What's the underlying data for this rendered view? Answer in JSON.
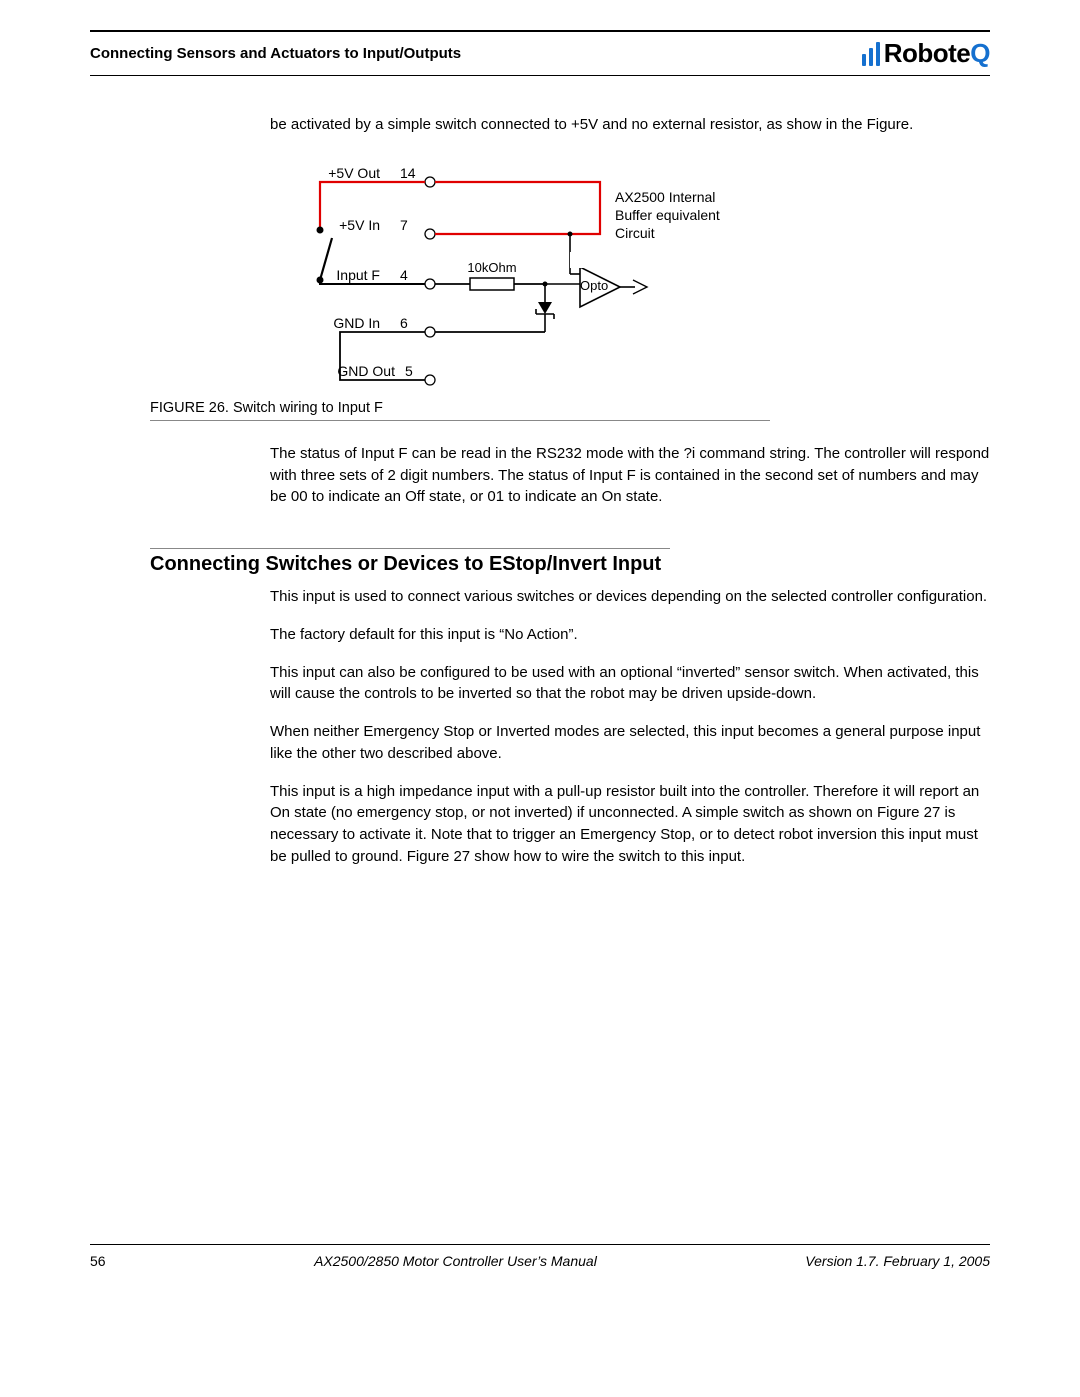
{
  "header": {
    "title": "Connecting Sensors and Actuators to Input/Outputs",
    "logo_text_a": "Robote",
    "logo_text_b": "Q"
  },
  "body": {
    "p_intro": "be activated by a simple switch connected to +5V and no external resistor, as show in the Figure.",
    "p_status": "The status of Input F can be read in the RS232 mode with the ?i command string. The controller will respond with three sets of 2 digit numbers. The status of Input F is contained in the second set of numbers and may be 00 to indicate an Off state, or 01 to indicate an On state.",
    "section_heading": "Connecting Switches or Devices to EStop/Invert Input",
    "p_sec1": "This input is used to connect various switches or devices depending on the selected controller configuration.",
    "p_sec2": "The factory default for this input is “No Action”.",
    "p_sec3": "This input can also be configured to be used with an optional “inverted” sensor switch. When activated, this will cause the controls to be inverted so that the robot may be driven upside-down.",
    "p_sec4": "When neither Emergency Stop or Inverted modes are selected, this input becomes a general purpose input like the other two described above.",
    "p_sec5": "This input is a high impedance input with a pull-up resistor built into the controller. Therefore it will report an On state (no emergency stop, or not inverted) if unconnected. A simple switch as shown on Figure 27 is necessary to activate it. Note that to trigger an Emergency Stop, or to detect robot inversion this input must be pulled to ground. Figure 27 show how to wire the switch to this input."
  },
  "figure": {
    "caption": "FIGURE 26.  Switch wiring to Input F",
    "labels": {
      "v5out": "+5V Out",
      "v5out_pin": "14",
      "v5in": "+5V In",
      "v5in_pin": "7",
      "inputf": "Input F",
      "inputf_pin": "4",
      "gndin": "GND In",
      "gndin_pin": "6",
      "gndout": "GND Out",
      "gndout_pin": "5",
      "resistor": "10kOhm",
      "opto": "Opto",
      "desc_l1": "AX2500 Internal",
      "desc_l2": "Buffer equivalent",
      "desc_l3": "Circuit"
    }
  },
  "footer": {
    "page": "56",
    "center": "AX2500/2850 Motor Controller User’s Manual",
    "right": "Version 1.7. February 1, 2005"
  }
}
